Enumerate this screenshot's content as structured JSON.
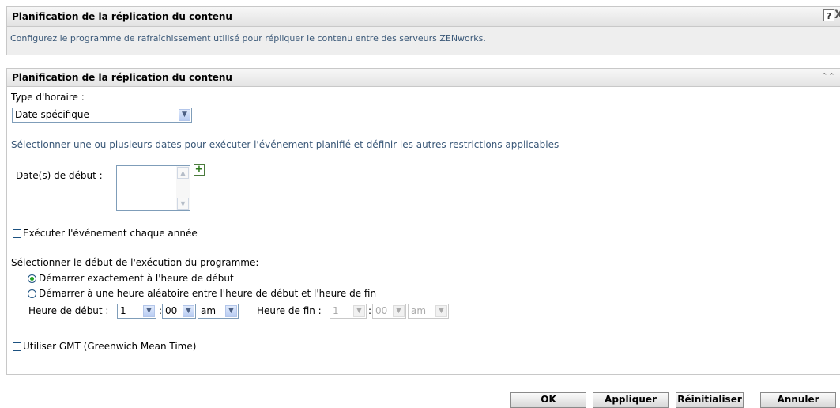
{
  "header": {
    "title": "Planification de la réplication du contenu",
    "description": "Configurez le programme de rafraîchissement utilisé pour répliquer le contenu entre des serveurs ZENworks.",
    "help_label": "?",
    "close_label": "X"
  },
  "panel": {
    "title": "Planification de la réplication du contenu",
    "collapse_label": "«",
    "schedule_type_label": "Type d'horaire :",
    "schedule_type_value": "Date spécifique",
    "instruction": "Sélectionner une ou plusieurs dates pour exécuter l'événement planifié et définir les autres restrictions applicables",
    "start_dates_label": "Date(s) de début :",
    "add_label": "+",
    "yearly_checkbox_label": "Exécuter l'événement chaque année",
    "yearly_checked": false,
    "start_mode_label": "Sélectionner le début de l'exécution du programme:",
    "start_mode_options": [
      "Démarrer exactement à l'heure de début",
      "Démarrer à une heure aléatoire entre l'heure de début et l'heure de fin"
    ],
    "start_mode_selected": 0,
    "start_time_label": "Heure de début :",
    "start_hour": "1",
    "start_minute": "00",
    "start_ampm": "am",
    "end_time_label": "Heure de fin :",
    "end_hour": "1",
    "end_minute": "00",
    "end_ampm": "am",
    "time_separator": ":",
    "gmt_checkbox_label": "Utiliser GMT (Greenwich Mean Time)",
    "gmt_checked": false
  },
  "footer": {
    "ok_label": "OK",
    "apply_label": "Appliquer",
    "reset_label": "Réinitialiser",
    "cancel_label": "Annuler"
  },
  "colors": {
    "description_text": "#3a5878",
    "accent_border": "#7f9db9",
    "radio_selected": "#21a121"
  }
}
